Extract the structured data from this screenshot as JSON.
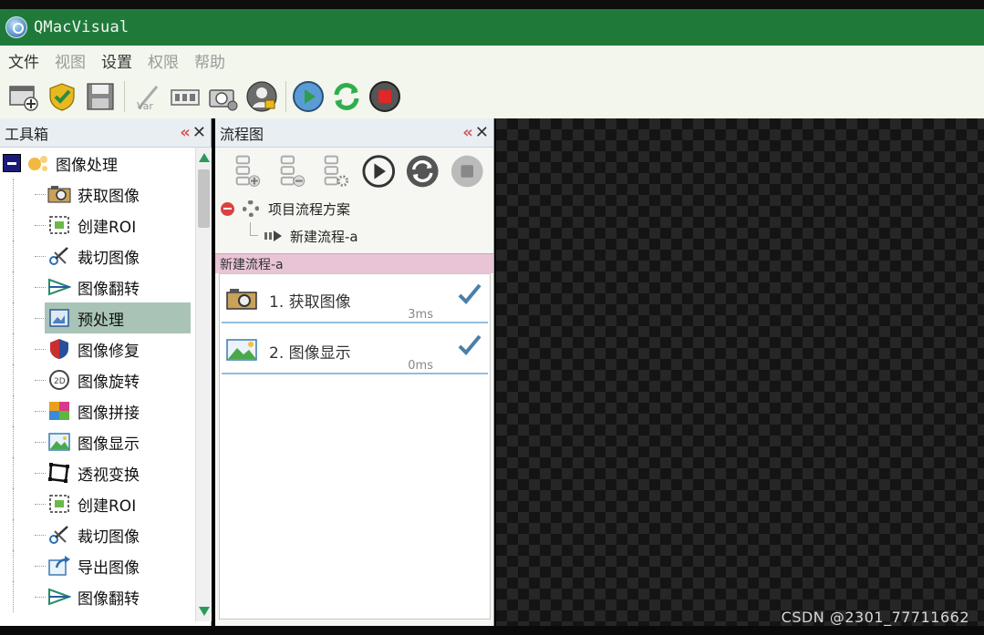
{
  "window": {
    "title": "QMacVisual"
  },
  "menu": [
    {
      "label": "文件",
      "disabled": false
    },
    {
      "label": "视图",
      "disabled": true
    },
    {
      "label": "设置",
      "disabled": false
    },
    {
      "label": "权限",
      "disabled": true
    },
    {
      "label": "帮助",
      "disabled": true
    }
  ],
  "toolbox": {
    "title": "工具箱",
    "root_label": "图像处理",
    "items": [
      {
        "label": "获取图像",
        "icon": "camera-icon"
      },
      {
        "label": "创建ROI",
        "icon": "roi-icon"
      },
      {
        "label": "裁切图像",
        "icon": "scissors-icon"
      },
      {
        "label": "图像翻转",
        "icon": "flip-icon"
      },
      {
        "label": "预处理",
        "icon": "preprocess-icon"
      },
      {
        "label": "图像修复",
        "icon": "shield-icon"
      },
      {
        "label": "图像旋转",
        "icon": "rotate-icon"
      },
      {
        "label": "图像拼接",
        "icon": "puzzle-icon"
      },
      {
        "label": "图像显示",
        "icon": "image-icon"
      },
      {
        "label": "透视变换",
        "icon": "perspective-icon"
      },
      {
        "label": "创建ROI",
        "icon": "roi-icon"
      },
      {
        "label": "裁切图像",
        "icon": "scissors-icon"
      },
      {
        "label": "导出图像",
        "icon": "export-icon"
      },
      {
        "label": "图像翻转",
        "icon": "flip-icon"
      }
    ],
    "selected_index": 4
  },
  "flow_panel": {
    "title": "流程图",
    "project_label": "项目流程方案",
    "sub_flow_label": "新建流程-a",
    "tab_label": "新建流程-a",
    "steps": [
      {
        "label": "1. 获取图像",
        "time": "3ms",
        "icon": "camera-icon"
      },
      {
        "label": "2. 图像显示",
        "time": "0ms",
        "icon": "image-icon"
      }
    ]
  },
  "watermark": "CSDN @2301_77711662",
  "colors": {
    "titlebar": "#1f7a3a",
    "menubar": "#f3f6ec",
    "selected_item": "#a9c4b6",
    "flow_tab": "#e8c4d6",
    "check": "#4a7fa8"
  }
}
